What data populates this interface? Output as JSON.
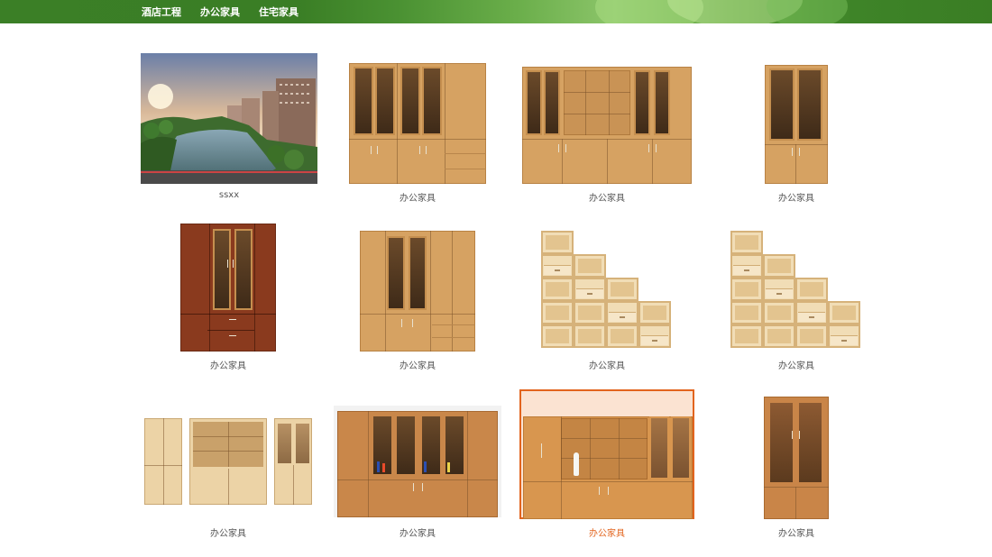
{
  "nav": {
    "items": [
      {
        "label": "酒店工程"
      },
      {
        "label": "办公家具"
      },
      {
        "label": "住宅家具"
      }
    ]
  },
  "products": [
    {
      "caption": "ssxx",
      "image": "city-river-landscape"
    },
    {
      "caption": "办公家具",
      "image": "wood-glass-bookcase"
    },
    {
      "caption": "办公家具",
      "image": "wide-wood-bookcase"
    },
    {
      "caption": "办公家具",
      "image": "two-door-glass-bookcase"
    },
    {
      "caption": "办公家具",
      "image": "mahogany-bookcase"
    },
    {
      "caption": "办公家具",
      "image": "wood-bookcase-center-glass"
    },
    {
      "caption": "办公家具",
      "image": "stepped-cube-shelf"
    },
    {
      "caption": "办公家具",
      "image": "stepped-cube-shelf"
    },
    {
      "caption": "办公家具",
      "image": "light-wood-cabinet-set"
    },
    {
      "caption": "办公家具",
      "image": "wide-bookcase-display"
    },
    {
      "caption": "办公家具",
      "image": "office-wall-cabinet",
      "selected": true
    },
    {
      "caption": "办公家具",
      "image": "glass-door-bookcase"
    }
  ],
  "colors": {
    "nav_bg": "#3b7f26",
    "caption": "#555555",
    "active_caption": "#e2641e",
    "active_border": "#e2641e"
  }
}
